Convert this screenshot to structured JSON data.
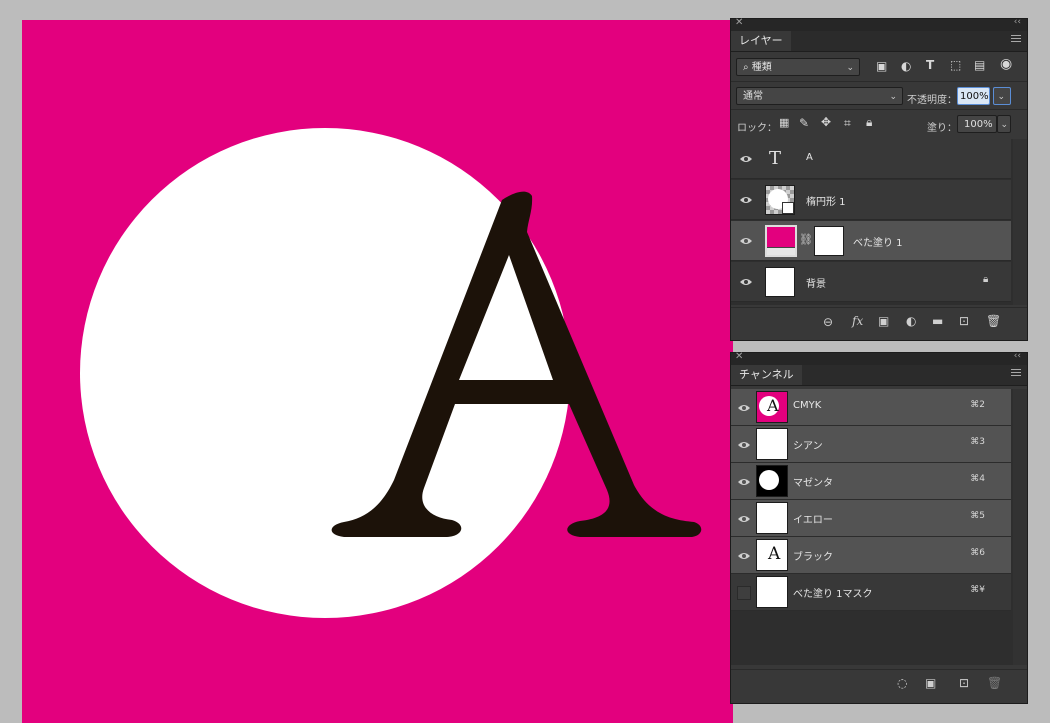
{
  "colors": {
    "canvas": "#e3007e",
    "circle": "#ffffff",
    "glyph": "#1c1209",
    "panel": "#383838",
    "selected_row": "#535353"
  },
  "canvas": {
    "letter": "A"
  },
  "layers_panel": {
    "tab": "レイヤー",
    "filter_label": "種類",
    "blend_mode": "通常",
    "opacity_label": "不透明度：",
    "opacity_value": "100%",
    "lock_label": "ロック：",
    "fill_label": "塗り：",
    "fill_value": "100%",
    "layers": [
      {
        "name": "A",
        "type": "text",
        "visible": true,
        "selected": false
      },
      {
        "name": "楕円形 1",
        "type": "shape",
        "visible": true,
        "selected": false
      },
      {
        "name": "べた塗り 1",
        "type": "fill",
        "visible": true,
        "selected": true
      },
      {
        "name": "背景",
        "type": "background",
        "visible": true,
        "selected": false,
        "locked": true
      }
    ],
    "footer_icons": [
      "link-icon",
      "fx-icon",
      "mask-icon",
      "adjustment-icon",
      "folder-icon",
      "new-layer-icon",
      "trash-icon"
    ]
  },
  "channels_panel": {
    "tab": "チャンネル",
    "channels": [
      {
        "name": "CMYK",
        "shortcut": "⌘2",
        "visible": true
      },
      {
        "name": "シアン",
        "shortcut": "⌘3",
        "visible": true
      },
      {
        "name": "マゼンタ",
        "shortcut": "⌘4",
        "visible": true
      },
      {
        "name": "イエロー",
        "shortcut": "⌘5",
        "visible": true
      },
      {
        "name": "ブラック",
        "shortcut": "⌘6",
        "visible": true
      },
      {
        "name": "べた塗り 1マスク",
        "shortcut": "⌘¥",
        "visible": false
      }
    ],
    "footer_icons": [
      "load-selection-icon",
      "save-selection-icon",
      "new-channel-icon",
      "trash-icon"
    ]
  }
}
